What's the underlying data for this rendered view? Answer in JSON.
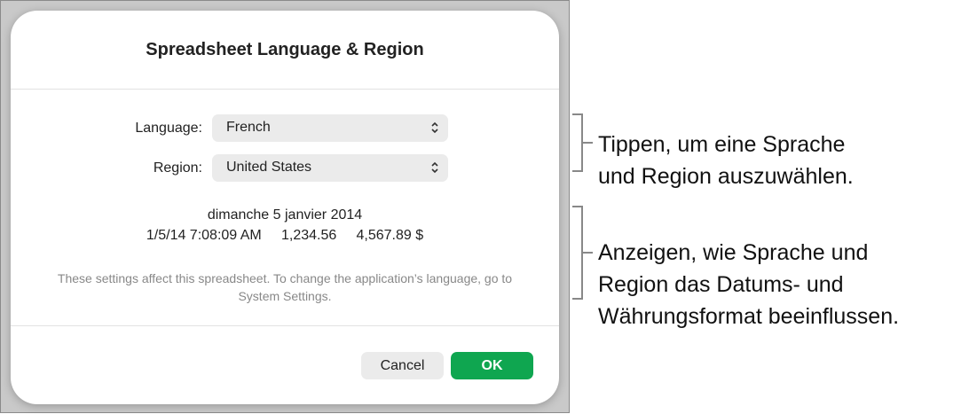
{
  "dialog": {
    "title": "Spreadsheet Language & Region",
    "language_label": "Language:",
    "language_value": "French",
    "region_label": "Region:",
    "region_value": "United States",
    "preview_date": "dimanche 5 janvier 2014",
    "preview_time": "1/5/14 7:08:09 AM",
    "preview_number": "1,234.56",
    "preview_currency": "4,567.89 $",
    "note": "These settings affect this spreadsheet. To change the application’s language, go to System Settings.",
    "cancel_label": "Cancel",
    "ok_label": "OK"
  },
  "callouts": {
    "select_line1": "Tippen, um eine Sprache",
    "select_line2": "und Region auszuwählen.",
    "preview_line1": "Anzeigen, wie Sprache und",
    "preview_line2": "Region das Datums- und",
    "preview_line3": "Währungsformat beeinflussen."
  },
  "colors": {
    "accent": "#0fa650"
  }
}
